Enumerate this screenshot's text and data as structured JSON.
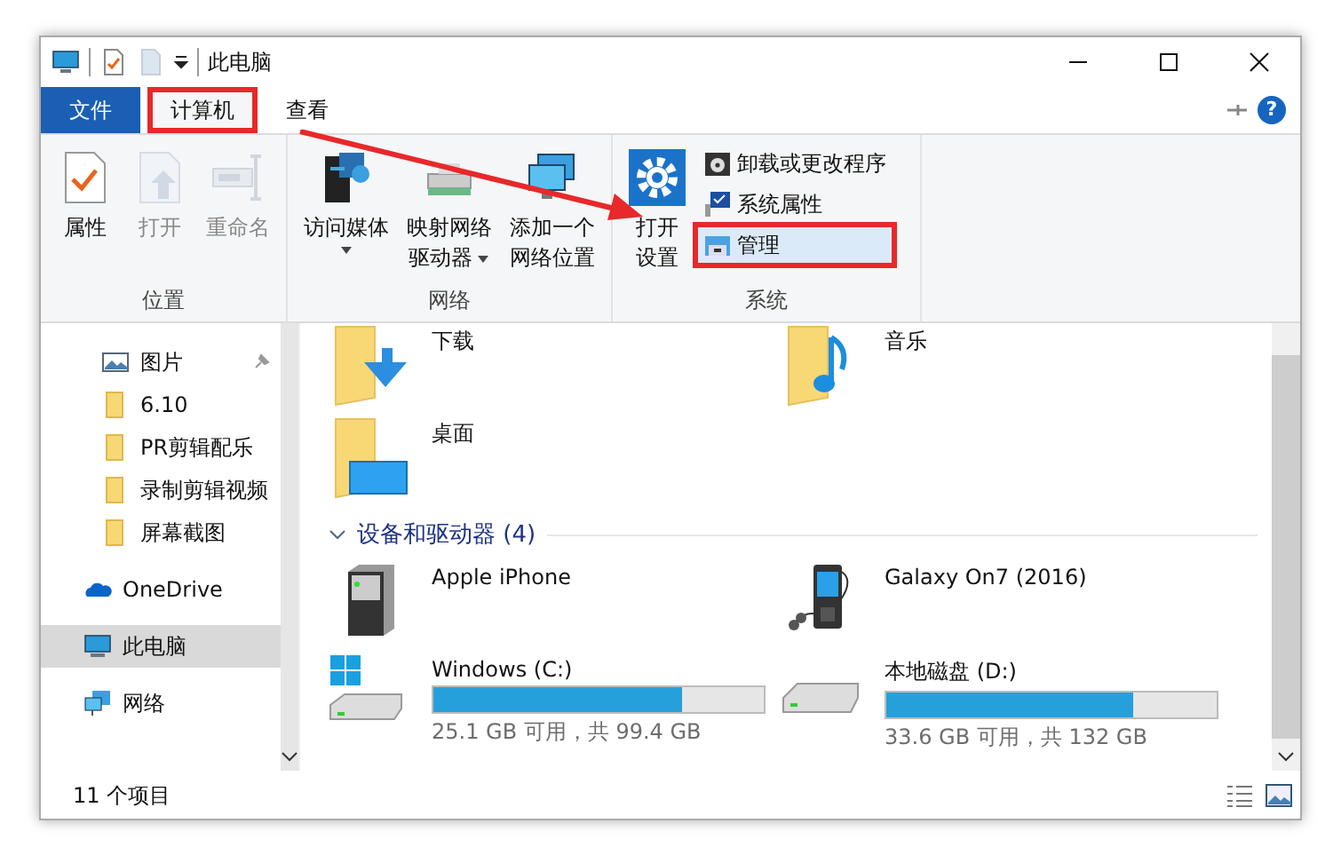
{
  "window": {
    "title": "此电脑"
  },
  "tabs": [
    {
      "label": "文件",
      "kind": "file",
      "selected": false,
      "highlighted": false
    },
    {
      "label": "计算机",
      "kind": "tab",
      "selected": true,
      "highlighted": true
    },
    {
      "label": "查看",
      "kind": "tab",
      "selected": false,
      "highlighted": false
    }
  ],
  "help_button": "?",
  "ribbon": {
    "groups": [
      {
        "label": "位置",
        "large": [
          {
            "lines": [
              "属性"
            ],
            "disabled": false,
            "dropdown": false
          },
          {
            "lines": [
              "打开"
            ],
            "disabled": true,
            "dropdown": false
          },
          {
            "lines": [
              "重命名"
            ],
            "disabled": true,
            "dropdown": false
          }
        ]
      },
      {
        "label": "网络",
        "large": [
          {
            "lines": [
              "访问媒体"
            ],
            "disabled": false,
            "dropdown": true
          },
          {
            "lines": [
              "映射网络",
              "驱动器"
            ],
            "disabled": false,
            "dropdown": true
          },
          {
            "lines": [
              "添加一个",
              "网络位置"
            ],
            "disabled": false,
            "dropdown": false
          }
        ]
      },
      {
        "label": "系统",
        "large": [
          {
            "lines": [
              "打开",
              "设置"
            ],
            "disabled": false,
            "dropdown": false
          }
        ],
        "small": [
          {
            "label": "卸载或更改程序",
            "highlighted": false
          },
          {
            "label": "系统属性",
            "highlighted": false
          },
          {
            "label": "管理",
            "highlighted": true
          }
        ]
      }
    ]
  },
  "sidebar": {
    "items": [
      {
        "label": "图片",
        "pinned": true,
        "selected": false
      },
      {
        "label": "6.10",
        "pinned": false,
        "selected": false
      },
      {
        "label": "PR剪辑配乐",
        "pinned": false,
        "selected": false
      },
      {
        "label": "录制剪辑视频",
        "pinned": false,
        "selected": false
      },
      {
        "label": "屏幕截图",
        "pinned": false,
        "selected": false
      },
      {
        "label": "OneDrive",
        "pinned": false,
        "selected": false
      },
      {
        "label": "此电脑",
        "pinned": false,
        "selected": true
      },
      {
        "label": "网络",
        "pinned": false,
        "selected": false
      }
    ]
  },
  "folders": [
    {
      "name": "下载"
    },
    {
      "name": "音乐"
    },
    {
      "name": "桌面"
    }
  ],
  "devices_section": {
    "title": "设备和驱动器 (4)",
    "expanded": true
  },
  "devices": [
    {
      "name": "Apple iPhone",
      "kind": "device"
    },
    {
      "name": "Galaxy On7 (2016)",
      "kind": "device"
    },
    {
      "name": "Windows (C:)",
      "kind": "drive",
      "level": 0.75,
      "info": "25.1 GB 可用，共 99.4 GB"
    },
    {
      "name": "本地磁盘 (D:)",
      "kind": "drive",
      "level": 0.745,
      "info": "33.6 GB 可用，共 132 GB"
    }
  ],
  "status_bar": {
    "count": "11 个项目"
  }
}
